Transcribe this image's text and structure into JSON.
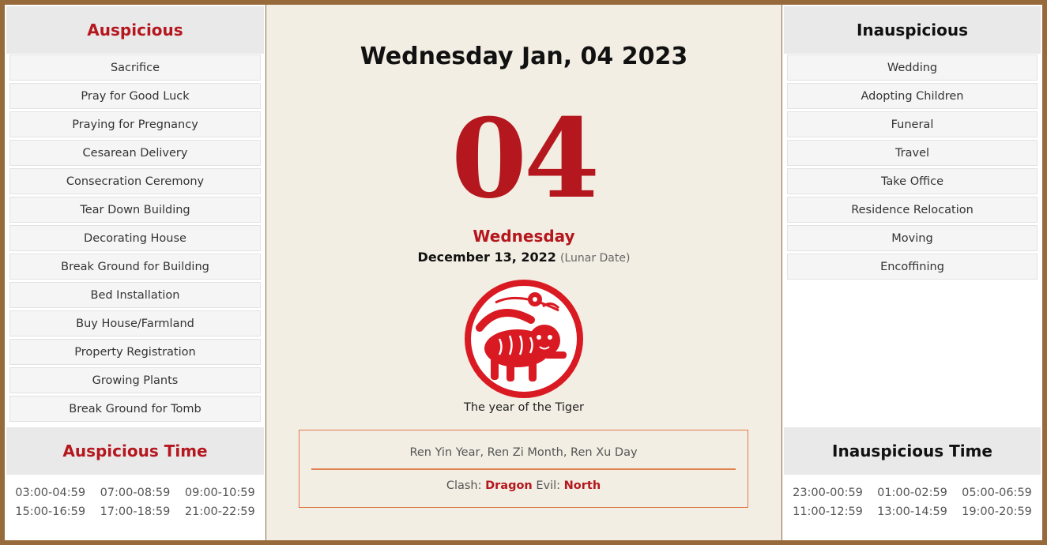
{
  "auspicious": {
    "title": "Auspicious",
    "items": [
      "Sacrifice",
      "Pray for Good Luck",
      "Praying for Pregnancy",
      "Cesarean Delivery",
      "Consecration Ceremony",
      "Tear Down Building",
      "Decorating House",
      "Break Ground for Building",
      "Bed Installation",
      "Buy House/Farmland",
      "Property Registration",
      "Growing Plants",
      "Break Ground for Tomb"
    ]
  },
  "inauspicious": {
    "title": "Inauspicious",
    "items": [
      "Wedding",
      "Adopting Children",
      "Funeral",
      "Travel",
      "Take Office",
      "Residence Relocation",
      "Moving",
      "Encoffining"
    ]
  },
  "auspicious_time": {
    "title": "Auspicious Time",
    "slots": [
      "03:00-04:59",
      "07:00-08:59",
      "09:00-10:59",
      "15:00-16:59",
      "17:00-18:59",
      "21:00-22:59"
    ]
  },
  "inauspicious_time": {
    "title": "Inauspicious Time",
    "slots": [
      "23:00-00:59",
      "01:00-02:59",
      "05:00-06:59",
      "11:00-12:59",
      "13:00-14:59",
      "19:00-20:59"
    ]
  },
  "center": {
    "title": "Wednesday Jan, 04 2023",
    "day_number": "04",
    "weekday": "Wednesday",
    "lunar_date": "December 13, 2022",
    "lunar_note": "(Lunar Date)",
    "zodiac_icon": "tiger-papercut-icon",
    "year_label": "The year of the Tiger",
    "ganzhi": "Ren Yin Year, Ren Zi Month, Ren Xu Day",
    "clash_label": "Clash:",
    "clash_value": "Dragon",
    "evil_label": "Evil:",
    "evil_value": "North"
  },
  "colors": {
    "accent_red": "#b5171e",
    "frame_brown": "#976a3b",
    "box_orange": "#e07b4d",
    "paper": "#f3eee3"
  }
}
